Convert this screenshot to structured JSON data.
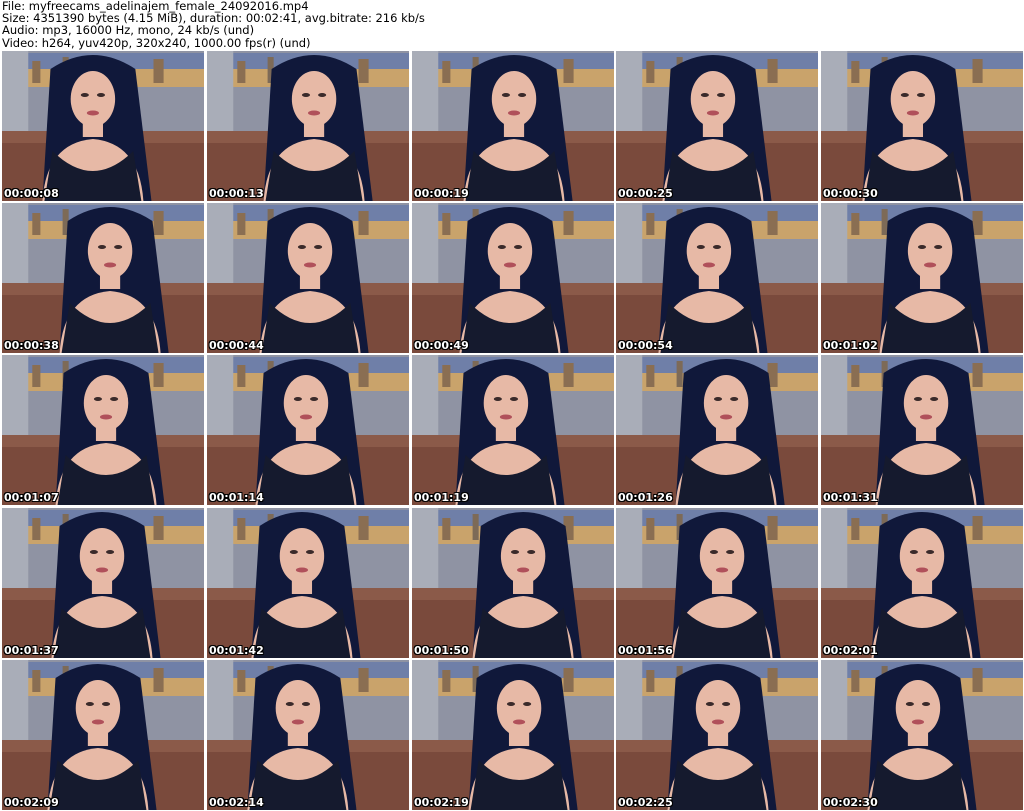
{
  "header": {
    "file_line": "File: myfreecams_adelinajem_female_24092016.mp4",
    "size_line": "Size: 4351390 bytes (4.15 MiB), duration: 00:02:41, avg.bitrate: 216 kb/s",
    "audio_line": "Audio: mp3, 16000 Hz, mono, 24 kb/s (und)",
    "video_line": "Video: h264, yuv420p, 320x240, 1000.00 fps(r) (und)"
  },
  "thumbnails": [
    {
      "timestamp": "00:00:08"
    },
    {
      "timestamp": "00:00:13"
    },
    {
      "timestamp": "00:00:19"
    },
    {
      "timestamp": "00:00:25"
    },
    {
      "timestamp": "00:00:30"
    },
    {
      "timestamp": "00:00:38"
    },
    {
      "timestamp": "00:00:44"
    },
    {
      "timestamp": "00:00:49"
    },
    {
      "timestamp": "00:00:54"
    },
    {
      "timestamp": "00:01:02"
    },
    {
      "timestamp": "00:01:07"
    },
    {
      "timestamp": "00:01:14"
    },
    {
      "timestamp": "00:01:19"
    },
    {
      "timestamp": "00:01:26"
    },
    {
      "timestamp": "00:01:31"
    },
    {
      "timestamp": "00:01:37"
    },
    {
      "timestamp": "00:01:42"
    },
    {
      "timestamp": "00:01:50"
    },
    {
      "timestamp": "00:01:56"
    },
    {
      "timestamp": "00:02:01"
    },
    {
      "timestamp": "00:02:09"
    },
    {
      "timestamp": "00:02:14"
    },
    {
      "timestamp": "00:02:19"
    },
    {
      "timestamp": "00:02:25"
    },
    {
      "timestamp": "00:02:30"
    }
  ],
  "colors": {
    "wall": "#8f93a3",
    "skyline": "#c9a36b",
    "couch": "#7a4a3c",
    "hair": "#10183a",
    "skin": "#e7b9a6",
    "top": "#151a2e"
  }
}
